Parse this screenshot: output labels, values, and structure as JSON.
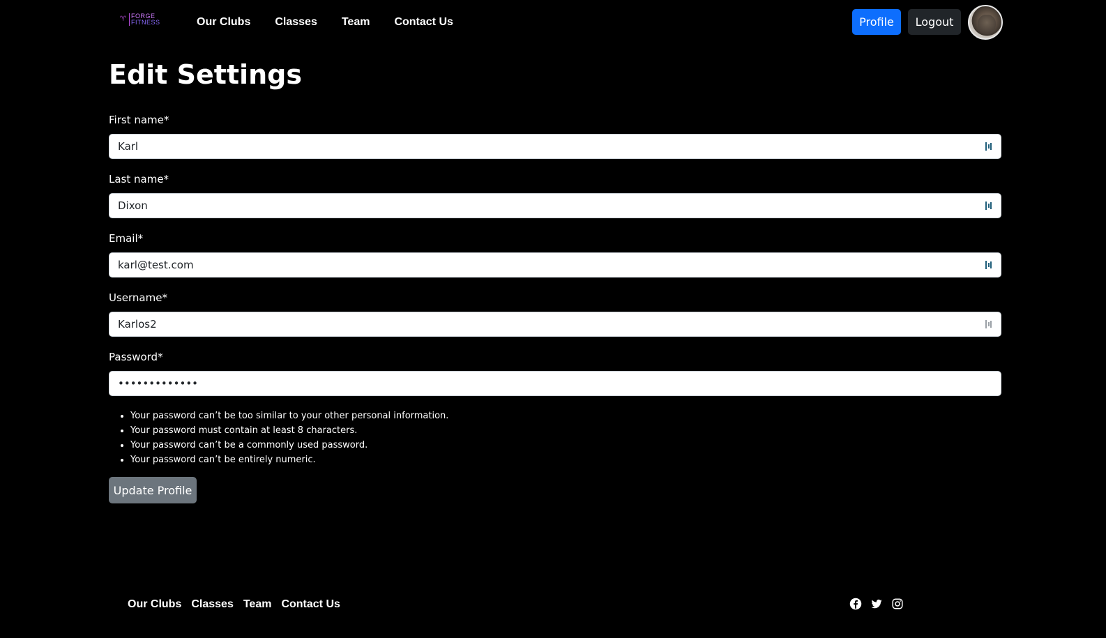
{
  "brand": {
    "line1": "FORGE",
    "line2": "FITNESS"
  },
  "nav": {
    "links": [
      "Our Clubs",
      "Classes",
      "Team",
      "Contact Us"
    ],
    "profile_label": "Profile",
    "logout_label": "Logout"
  },
  "page": {
    "title": "Edit Settings"
  },
  "form": {
    "first_name": {
      "label": "First name*",
      "value": "Karl"
    },
    "last_name": {
      "label": "Last name*",
      "value": "Dixon"
    },
    "email": {
      "label": "Email*",
      "value": "karl@test.com"
    },
    "username": {
      "label": "Username*",
      "value": "Karlos2"
    },
    "password": {
      "label": "Password*",
      "value": "•••••••••••••"
    },
    "rules": [
      "Your password can’t be too similar to your other personal information.",
      "Your password must contain at least 8 characters.",
      "Your password can’t be a commonly used password.",
      "Your password can’t be entirely numeric."
    ],
    "submit_label": "Update Profile"
  },
  "footer": {
    "links": [
      "Our Clubs",
      "Classes",
      "Team",
      "Contact Us"
    ],
    "socials": [
      "facebook-icon",
      "twitter-icon",
      "instagram-icon"
    ]
  },
  "colors": {
    "background": "#000000",
    "primary": "#0d6efd",
    "dark_button": "#212529",
    "secondary_button": "#6c757d",
    "brand_purple": "#9b5cff"
  }
}
